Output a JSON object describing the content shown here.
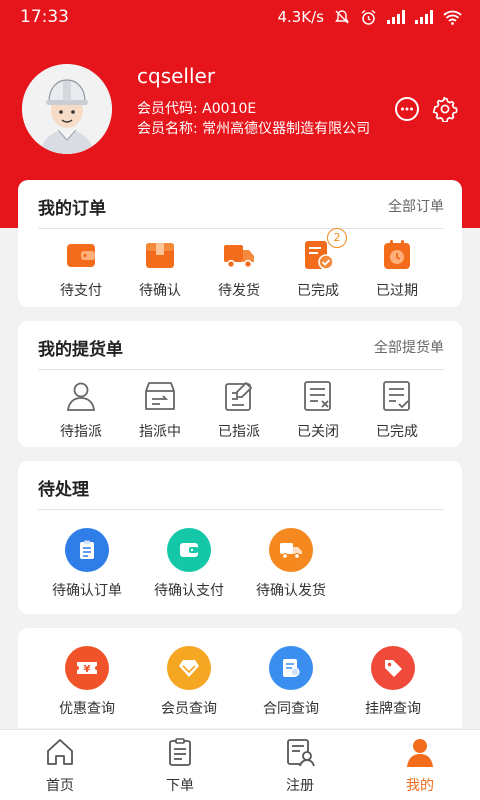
{
  "status_bar": {
    "time": "17:33",
    "net_speed": "4.3K/s"
  },
  "profile": {
    "username": "cqseller",
    "member_code": "会员代码: A0010E",
    "member_name": "会员名称: 常州高德仪器制造有限公司"
  },
  "orders": {
    "title": "我的订单",
    "link": "全部订单",
    "items": [
      {
        "label": "待支付",
        "icon": "wallet-icon"
      },
      {
        "label": "待确认",
        "icon": "box-icon"
      },
      {
        "label": "待发货",
        "icon": "truck-icon"
      },
      {
        "label": "已完成",
        "icon": "check-doc-icon",
        "badge": "2"
      },
      {
        "label": "已过期",
        "icon": "clock-doc-icon"
      }
    ]
  },
  "pickup": {
    "title": "我的提货单",
    "link": "全部提货单",
    "items": [
      {
        "label": "待指派",
        "icon": "person-icon"
      },
      {
        "label": "指派中",
        "icon": "transfer-icon"
      },
      {
        "label": "已指派",
        "icon": "edit-doc-icon"
      },
      {
        "label": "已关闭",
        "icon": "close-doc-icon"
      },
      {
        "label": "已完成",
        "icon": "done-doc-icon"
      }
    ]
  },
  "pending": {
    "title": "待处理",
    "items": [
      {
        "label": "待确认订单",
        "icon": "clipboard-icon",
        "color": "#2f7ee8"
      },
      {
        "label": "待确认支付",
        "icon": "wallet-icon",
        "color": "#14c7a7"
      },
      {
        "label": "待确认发货",
        "icon": "truck-icon",
        "color": "#f5891f"
      }
    ]
  },
  "queries": {
    "items": [
      {
        "label": "优惠查询",
        "icon": "coupon-icon",
        "color": "#f0522a"
      },
      {
        "label": "会员查询",
        "icon": "diamond-icon",
        "color": "#f5a623"
      },
      {
        "label": "合同查询",
        "icon": "contract-icon",
        "color": "#3a8ef0"
      },
      {
        "label": "挂牌查询",
        "icon": "tag-icon",
        "color": "#ef4a3a"
      }
    ]
  },
  "tabbar": {
    "items": [
      {
        "label": "首页",
        "icon": "home-icon"
      },
      {
        "label": "下单",
        "icon": "order-icon"
      },
      {
        "label": "注册",
        "icon": "register-icon"
      },
      {
        "label": "我的",
        "icon": "user-icon",
        "active": true
      }
    ],
    "active_color": "#f26c1c"
  },
  "colors": {
    "header": "#e6141b",
    "accent": "#f5891f"
  }
}
